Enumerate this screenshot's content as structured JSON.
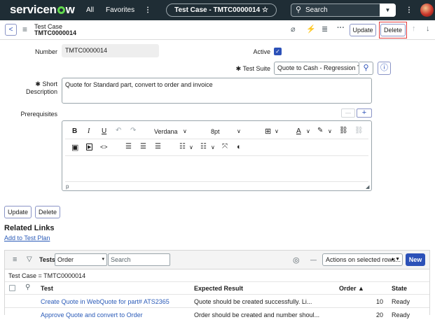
{
  "nav": {
    "logo_text_1": "servicen",
    "logo_text_2": "w",
    "all": "All",
    "favorites": "Favorites",
    "more": "⋮",
    "record_pill": "Test Case - TMTC0000014",
    "star": "☆",
    "search_placeholder": "Search",
    "search_icon": "⚲",
    "dropdown": "▼",
    "menu": "⋮"
  },
  "header": {
    "back": "<",
    "hamburger": "≡",
    "title": "Test Case",
    "number": "TMTC0000014",
    "attach_icon": "⌀",
    "activity_icon": "⚡",
    "settings_icon": "≣",
    "more": "···",
    "update": "Update",
    "delete": "Delete",
    "up": "↑",
    "down": "↓"
  },
  "form": {
    "number_label": "Number",
    "number_value": "TMTC0000014",
    "active_label": "Active",
    "active_check": "✓",
    "test_suite_req": "✱",
    "test_suite_label": "Test Suite",
    "test_suite_value": "Quote to Cash - Regression Tes",
    "lookup_icon": "⚲",
    "info_icon": "ⓘ",
    "short_desc_req": "✱",
    "short_desc_label_1": "Short",
    "short_desc_label_2": "Description",
    "short_desc_value": "Quote for Standard part, convert to order and invoice",
    "prereq_label": "Prerequisites",
    "minus": "—",
    "plus": "+"
  },
  "editor": {
    "bold": "B",
    "italic": "I",
    "underline": "U",
    "undo": "↶",
    "redo": "↷",
    "font": "Verdana",
    "size": "8pt",
    "caret": "∨",
    "table": "⊞",
    "fontcolor": "A",
    "highlight": "✎",
    "link": "⛓",
    "unlink": "⛓",
    "image": "▣",
    "video": "▶",
    "code": "<>",
    "align_left": "☰",
    "align_center": "☰",
    "align_right": "☰",
    "bullets": "☷",
    "numbered": "☷",
    "fullscreen": "⤧",
    "contrast": "◐",
    "status": "p"
  },
  "bottom": {
    "update": "Update",
    "delete": "Delete",
    "related_links": "Related Links",
    "add_to_plan": "Add to Test Plan"
  },
  "list": {
    "menu": "≡",
    "filter": "⚲",
    "title": "Tests",
    "order_select": "Order",
    "search_placeholder": "Search",
    "gear": "◎",
    "minus": "—",
    "actions": "Actions on selected rows...",
    "new": "New",
    "breadcrumb": "Test Case = TMTC0000014",
    "columns": [
      "Test",
      "Expected Result",
      "Order ▲",
      "State"
    ],
    "rows": [
      {
        "test": "Create Quote in WebQuote for part# ATS2365",
        "expected": "Quote should be created successfully. Li...",
        "order": "10",
        "state": "Ready"
      },
      {
        "test": "Approve Quote and convert to Order",
        "expected": "Order should be created and number shoul...",
        "order": "20",
        "state": "Ready"
      }
    ]
  },
  "colors": {
    "nav_bg": "#1f2d35",
    "logo_accent": "#62d84e",
    "link": "#2b5bb8",
    "primary": "#2c51b8",
    "delete_highlight": "#e23c3c"
  }
}
